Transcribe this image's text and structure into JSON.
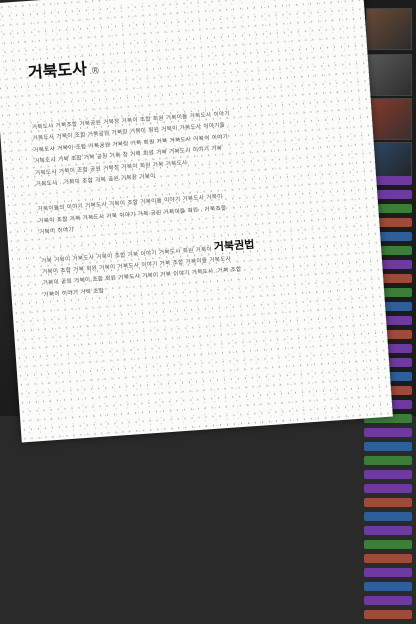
{
  "document": {
    "title": "거북도사",
    "title_mark": "®",
    "paragraph1": [
      "거북도사 거북조합 거북공원 거북장 거북이 조합 회원 거북이들 거북도사 이야기",
      "거북도사 거북이 조합 거북공원 거북장 거북이 회원 거북이 거북도사 이야기들",
      "거북도사 거북이 조합 거북공원 거북장 거북 회원 거북 거북도사 거북이 이야기",
      "거북도사 거북 조합 거북 공원 거북 장 거북 회원 거북 거북도사 이야기 거북",
      "거북도사 거북이 조합 공원 거북장 거북이 회원 거북 거북도사",
      "거북도사 . 거북이 조합 거북 공원 거북장 거북이"
    ],
    "paragraph2": [
      "거북이들의 이야기 거북도사 거북이 조합 거북이들 이야기 거북도사 거북이",
      "거북이 조합 거북 거북도사 거북 이야기 거북 공원 거북이들 회원 . 거북조합",
      "거북이 이야기"
    ],
    "paragraph3": [
      "거북 거북이 거북도사 거북이 조합 거북 이야기 거북도사 회원 거북이",
      "거북이 조합 거북 회원 거북이 거북도사 이야기 거북 조합 거북이들 거북도사",
      "거북이 공원 거북이 조합 회원 거북도사 거북이 거북 이야기 거북도사. 거북 조합",
      "거북이 이야기 거북 조합"
    ],
    "highlight": "거북권법"
  },
  "side_panel": {
    "chip_count_note": "",
    "chips": [
      "",
      "",
      "",
      "",
      "",
      "",
      "",
      "",
      "",
      "",
      "",
      "",
      "",
      "",
      "",
      "",
      "",
      "",
      "",
      "",
      "",
      "",
      "",
      "",
      "",
      "",
      "",
      "",
      "",
      "",
      "",
      ""
    ]
  },
  "colors": {
    "paper": "#fbfbf9",
    "title": "#111111",
    "body_text": "#555555",
    "background": "#222222",
    "chip_purple": "#6f3aa0",
    "chip_green": "#3c7d3a",
    "chip_red": "#a04a3a",
    "chip_blue": "#2f5f9a"
  }
}
